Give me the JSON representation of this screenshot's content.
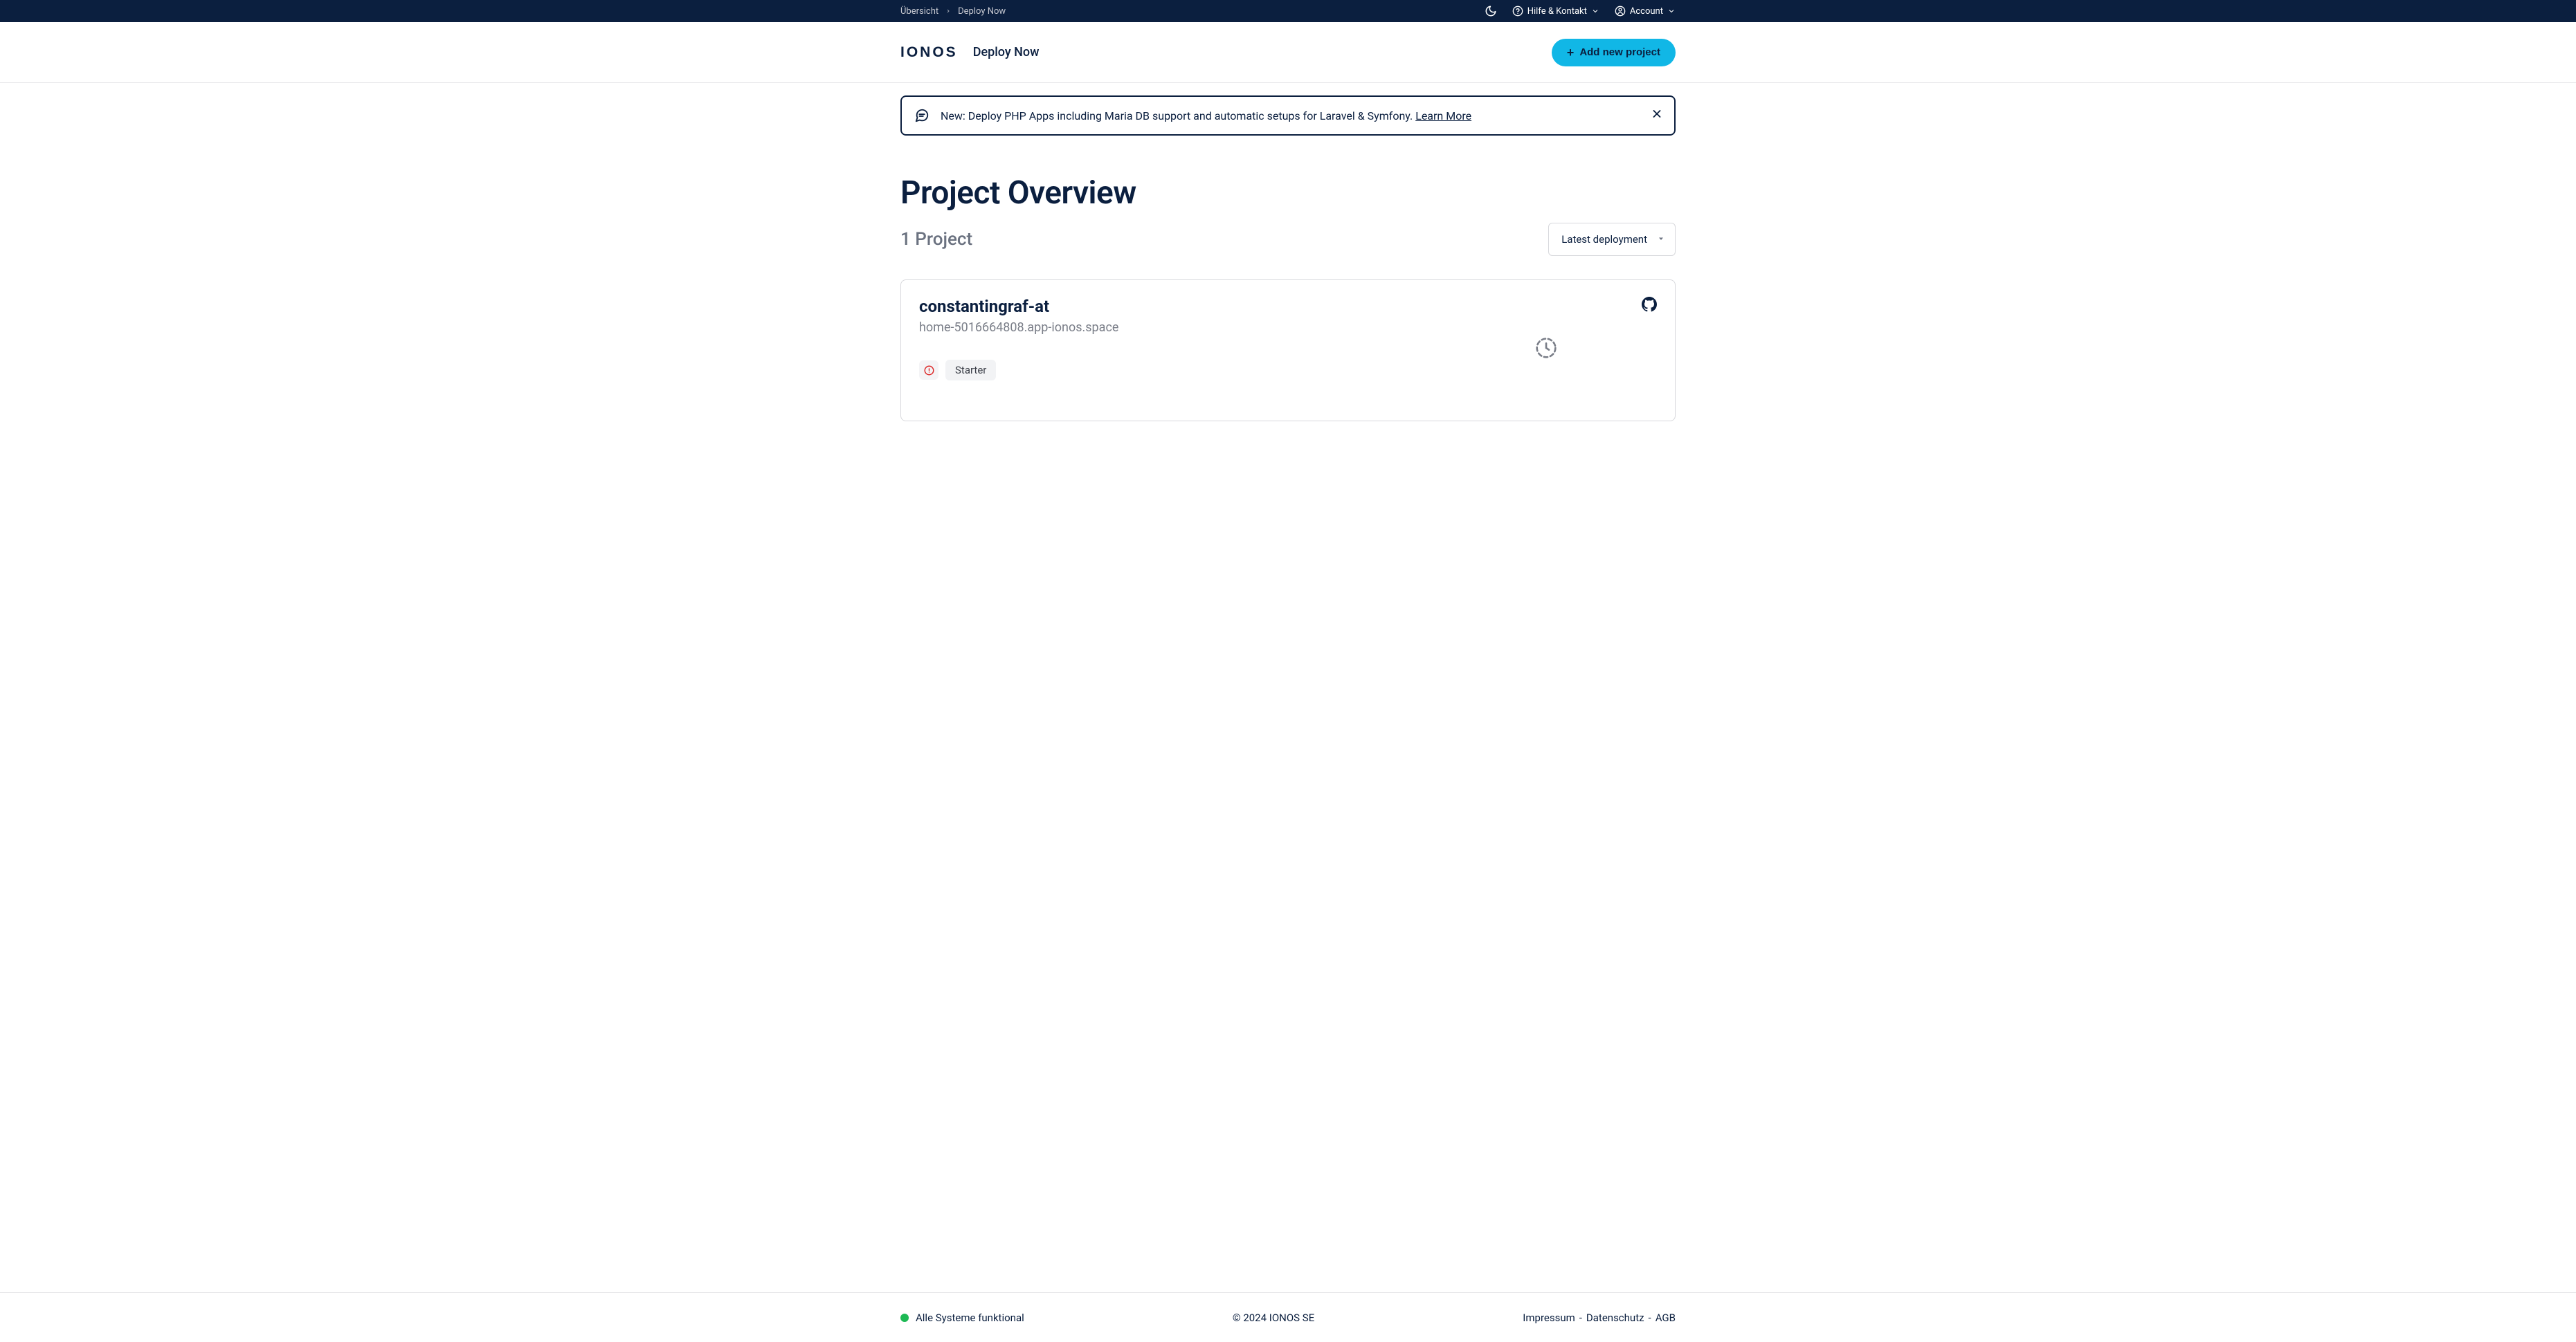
{
  "topbar": {
    "breadcrumb": {
      "root": "Übersicht",
      "current": "Deploy Now"
    },
    "help_label": "Hilfe & Kontakt",
    "account_label": "Account"
  },
  "header": {
    "logo_text": "IONOS",
    "product_name": "Deploy Now",
    "add_button_label": "Add new project"
  },
  "banner": {
    "text": "New: Deploy PHP Apps including Maria DB support and automatic setups for Laravel & Symfony. ",
    "link_text": "Learn More"
  },
  "main": {
    "title": "Project Overview",
    "project_count_label": "1 Project",
    "sort_label": "Latest deployment"
  },
  "project": {
    "name": "constantingraf-at",
    "domain": "home-5016664808.app-ionos.space",
    "plan": "Starter"
  },
  "footer": {
    "status_text": "Alle Systeme funktional",
    "copyright": "© 2024 IONOS SE",
    "links": {
      "impressum": "Impressum",
      "datenschutz": "Datenschutz",
      "agb": "AGB"
    }
  }
}
